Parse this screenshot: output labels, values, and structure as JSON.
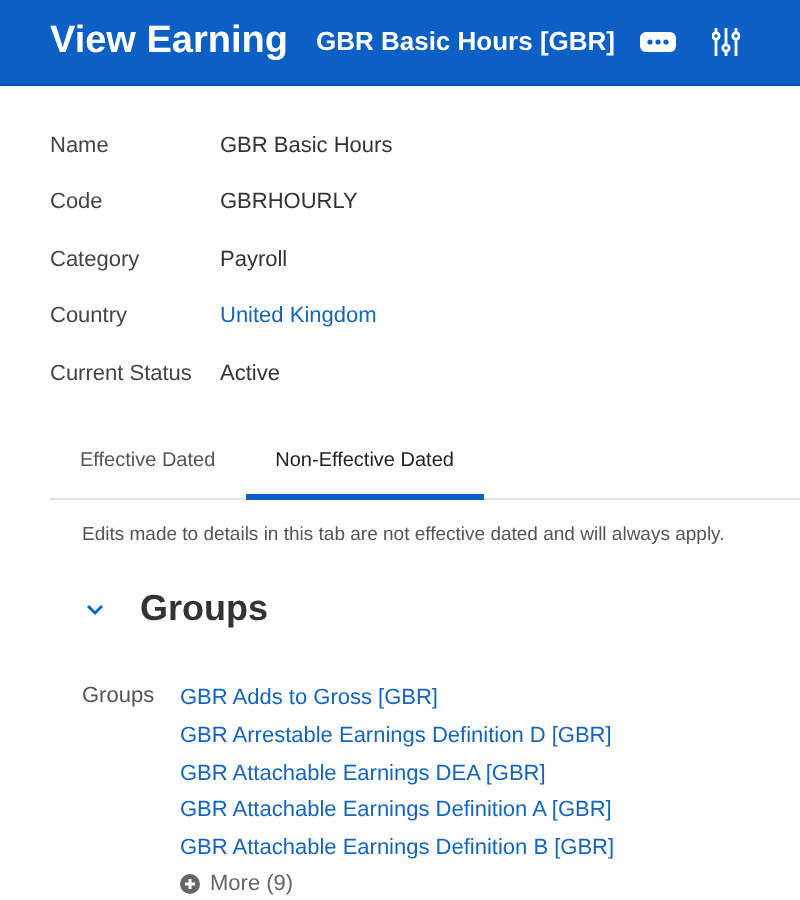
{
  "header": {
    "title": "View Earning",
    "subtitle": "GBR Basic Hours [GBR]"
  },
  "fields": [
    {
      "label": "Name",
      "value": "GBR Basic Hours",
      "kind": "text"
    },
    {
      "label": "Code",
      "value": "GBRHOURLY",
      "kind": "text"
    },
    {
      "label": "Category",
      "value": "Payroll",
      "kind": "text"
    },
    {
      "label": "Country",
      "value": "United Kingdom",
      "kind": "link"
    },
    {
      "label": "Current Status",
      "value": "Active",
      "kind": "text"
    }
  ],
  "tabs": [
    {
      "label": "Effective Dated",
      "selected": false
    },
    {
      "label": "Non-Effective Dated",
      "selected": true
    }
  ],
  "note": "Edits made to details in this tab are not effective dated and will always apply.",
  "section": {
    "title": "Groups",
    "expanded": true,
    "label": "Groups",
    "links": [
      "GBR Adds to Gross [GBR]",
      "GBR Arrestable Earnings Definition D [GBR]",
      "GBR Attachable Earnings DEA [GBR]",
      "GBR Attachable Earnings Definition A [GBR]",
      "GBR Attachable Earnings Definition B [GBR]"
    ],
    "more": "More (9)"
  }
}
